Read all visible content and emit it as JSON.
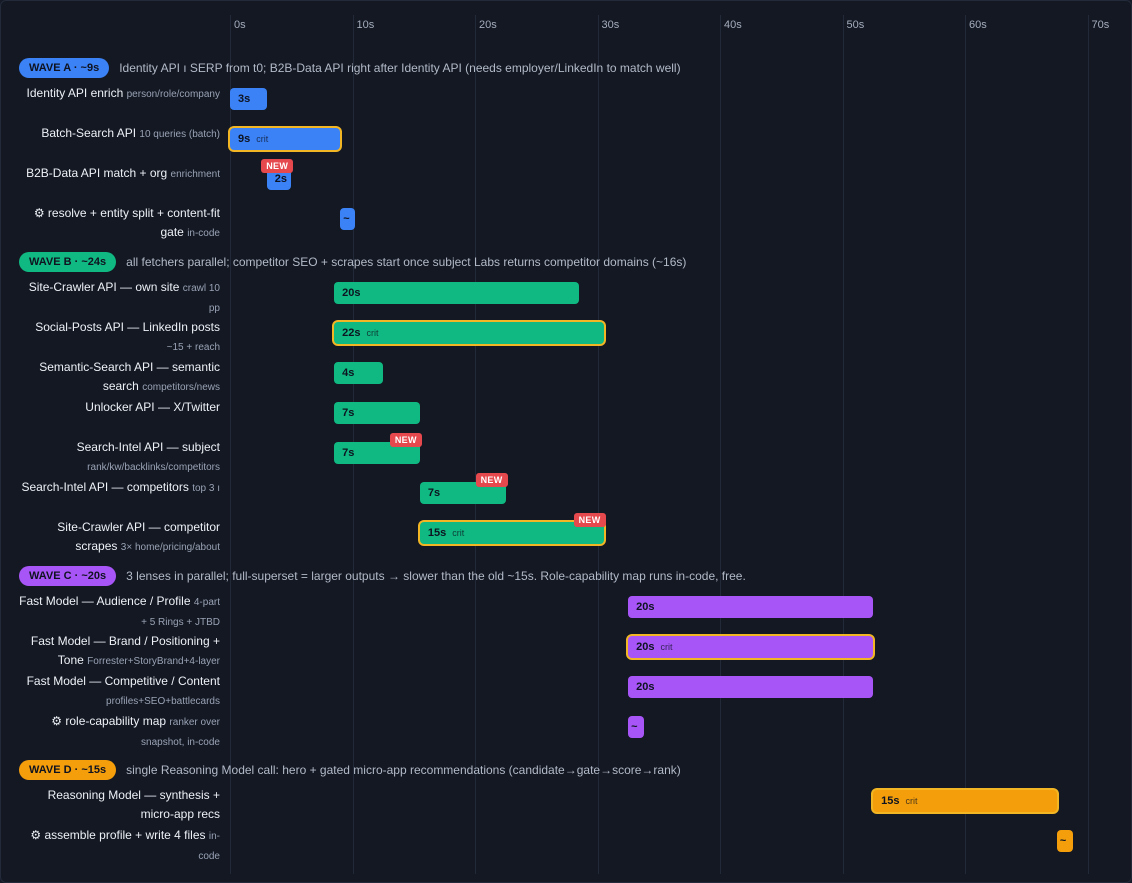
{
  "chart_data": {
    "type": "gantt",
    "x_unit": "s",
    "xlim": [
      0,
      70
    ],
    "x_ticks": [
      "0s",
      "10s",
      "20s",
      "30s",
      "40s",
      "50s",
      "60s",
      "70s"
    ],
    "grid": true,
    "waves": [
      {
        "badge": "WAVE A · ~9s",
        "note": "Identity API ı SERP from t0; B2B-Data API right after Identity API (needs employer/LinkedIn to match well)",
        "color": "#3b82f6",
        "tasks": [
          {
            "label": "Identity API enrich",
            "sub": "person/role/company",
            "start": 0,
            "duration": 3,
            "bar_text": "3s",
            "crit": false,
            "new": false
          },
          {
            "label": "Batch-Search API",
            "sub": "10 queries (batch)",
            "start": 0,
            "duration": 9,
            "bar_text": "9s",
            "crit": true,
            "new": false
          },
          {
            "label": "B2B-Data API match + org",
            "sub": "enrichment",
            "start": 3,
            "duration": 2,
            "bar_text": "2s",
            "crit": false,
            "new": true
          },
          {
            "label": "⚙ resolve + entity split + content-fit gate",
            "sub": "in-code",
            "start": 9,
            "duration": 1.2,
            "bar_text": "~",
            "crit": false,
            "new": false
          }
        ]
      },
      {
        "badge": "WAVE B · ~24s",
        "note": "all fetchers parallel; competitor SEO + scrapes start once subject Labs returns competitor domains (~16s)",
        "color": "#10b981",
        "tasks": [
          {
            "label": "Site-Crawler API — own site",
            "sub": "crawl 10 pp",
            "start": 8.5,
            "duration": 20,
            "bar_text": "20s",
            "crit": false,
            "new": false
          },
          {
            "label": "Social-Posts API — LinkedIn posts",
            "sub": "~15 + reach",
            "start": 8.5,
            "duration": 22,
            "bar_text": "22s",
            "crit": true,
            "new": false
          },
          {
            "label": "Semantic-Search API — semantic search",
            "sub": "competitors/news",
            "start": 8.5,
            "duration": 4,
            "bar_text": "4s",
            "crit": false,
            "new": false
          },
          {
            "label": "Unlocker API — X/Twitter",
            "sub": "",
            "start": 8.5,
            "duration": 7,
            "bar_text": "7s",
            "crit": false,
            "new": false
          },
          {
            "label": "Search-Intel API — subject",
            "sub": "rank/kw/backlinks/competitors",
            "start": 8.5,
            "duration": 7,
            "bar_text": "7s",
            "crit": false,
            "new": true
          },
          {
            "label": "Search-Intel API — competitors",
            "sub": "top 3 ı",
            "start": 15.5,
            "duration": 7,
            "bar_text": "7s",
            "crit": false,
            "new": true
          },
          {
            "label": "Site-Crawler API — competitor scrapes",
            "sub": "3× home/pricing/about",
            "start": 15.5,
            "duration": 15,
            "bar_text": "15s",
            "crit": true,
            "new": true
          }
        ]
      },
      {
        "badge": "WAVE C · ~20s",
        "note": "3 lenses in parallel; full-superset = larger outputs → slower than the old ~15s. Role-capability map runs in-code, free.",
        "color": "#a855f7",
        "tasks": [
          {
            "label": "Fast Model — Audience / Profile",
            "sub": "4-part + 5 Rings + JTBD",
            "start": 32.5,
            "duration": 20,
            "bar_text": "20s",
            "crit": false,
            "new": false
          },
          {
            "label": "Fast Model — Brand / Positioning + Tone",
            "sub": "Forrester+StoryBrand+4-layer",
            "start": 32.5,
            "duration": 20,
            "bar_text": "20s",
            "crit": true,
            "new": false
          },
          {
            "label": "Fast Model — Competitive / Content",
            "sub": "profiles+SEO+battlecards",
            "start": 32.5,
            "duration": 20,
            "bar_text": "20s",
            "crit": false,
            "new": false
          },
          {
            "label": "⚙ role-capability map",
            "sub": "ranker over snapshot, in-code",
            "start": 32.5,
            "duration": 1.3,
            "bar_text": "~",
            "crit": false,
            "new": false
          }
        ]
      },
      {
        "badge": "WAVE D · ~15s",
        "note": "single Reasoning Model call: hero + gated micro-app recommendations (candidate→gate→score→rank)",
        "color": "#f59e0b",
        "tasks": [
          {
            "label": "Reasoning Model — synthesis + micro-app recs",
            "sub": "",
            "start": 52.5,
            "duration": 15,
            "bar_text": "15s",
            "crit": true,
            "new": false
          },
          {
            "label": "⚙ assemble profile + write 4 files",
            "sub": "in-code",
            "start": 67.5,
            "duration": 1.3,
            "bar_text": "~",
            "crit": false,
            "new": false
          }
        ]
      }
    ],
    "new_badge_text": "NEW",
    "crit_tag_text": "crit"
  }
}
